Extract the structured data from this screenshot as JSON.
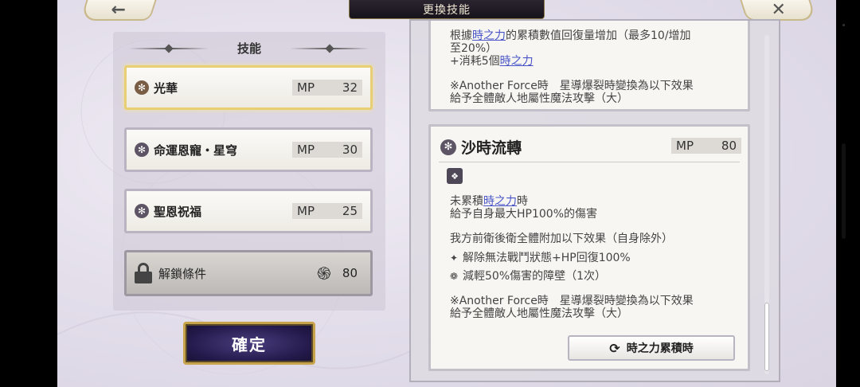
{
  "header": {
    "title": "更換技能",
    "back_icon": "←",
    "close_icon": "✕"
  },
  "left_panel": {
    "heading": "技能",
    "skills": [
      {
        "name": "光華",
        "mp_label": "MP",
        "mp": "32",
        "selected": true
      },
      {
        "name": "命運恩寵・星穹",
        "mp_label": "MP",
        "mp": "30",
        "selected": false
      },
      {
        "name": "聖恩祝福",
        "mp_label": "MP",
        "mp": "25",
        "selected": false
      }
    ],
    "locked": {
      "label": "解鎖條件",
      "value": "80"
    },
    "confirm_label": "確定"
  },
  "detail_top": {
    "line1_pre": "根據",
    "line1_hl": "時之力",
    "line1_post": "的累積數值回復量增加（最多10/增加",
    "line2": "至20%）",
    "line3_pre": "+消耗5個",
    "line3_hl": "時之力",
    "note1": "※Another Force時　星導爆裂時變換為以下效果",
    "note2": "給予全體敵人地屬性魔法攻擊（大）"
  },
  "detail_main": {
    "name": "沙時流轉",
    "mp_label": "MP",
    "mp": "80",
    "cond_pre": "未累積",
    "cond_hl": "時之力",
    "cond_post": "時",
    "dmg": "給予自身最大HP100%的傷害",
    "team": "我方前衛後衛全體附加以下效果（自身除外）",
    "effect1": "解除無法戰鬥狀態+HP回復100%",
    "effect2": "減輕50%傷害的障壁（1次）",
    "note1": "※Another Force時　星導爆裂時變換為以下效果",
    "note2": "給予全體敵人地屬性魔法攻擊（大）",
    "button_label": "時之力累積時"
  }
}
